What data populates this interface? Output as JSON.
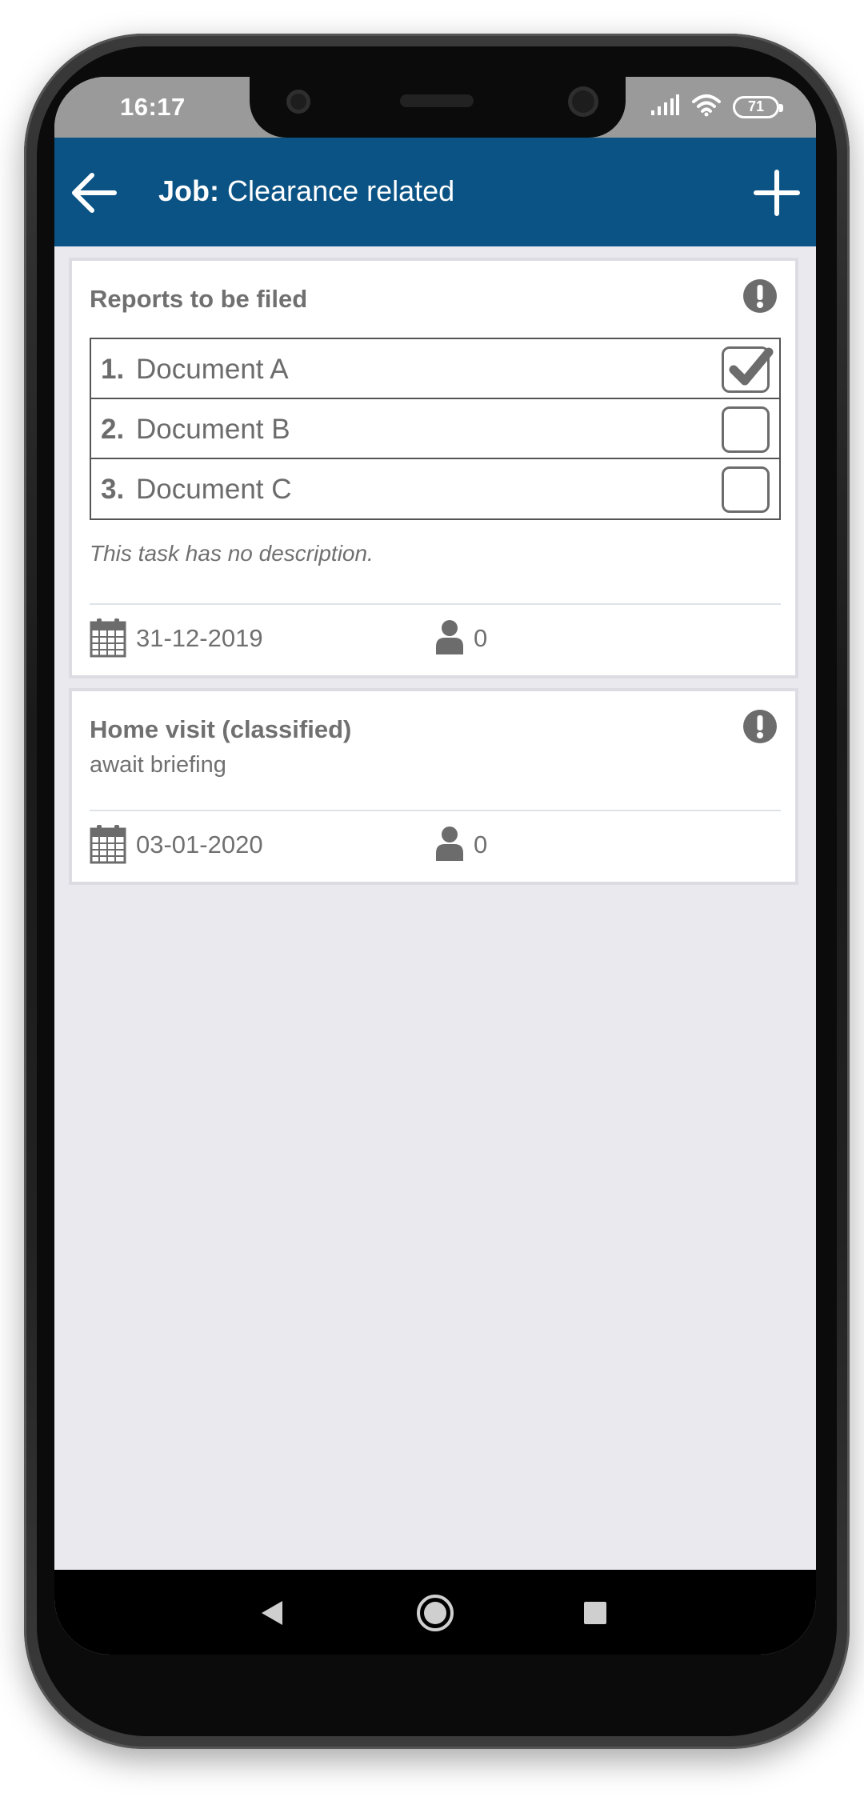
{
  "status_bar": {
    "time": "16:17",
    "battery": "71",
    "icons": [
      "signal-icon",
      "wifi-icon",
      "battery-icon"
    ]
  },
  "app_bar": {
    "title_label": "Job:",
    "title_value": "Clearance related",
    "back_icon": "arrow-left-icon",
    "add_icon": "plus-icon",
    "color": "#0a5384"
  },
  "tasks": [
    {
      "title": "Reports to be filed",
      "checklist": [
        {
          "num": "1.",
          "text": "Document A",
          "checked": true
        },
        {
          "num": "2.",
          "text": "Document B",
          "checked": false
        },
        {
          "num": "3.",
          "text": "Document C",
          "checked": false
        }
      ],
      "description": "This task has no description.",
      "date": "31-12-2019",
      "assignees": "0"
    },
    {
      "title": "Home visit (classified)",
      "subtitle": "await briefing",
      "date": "03-01-2020",
      "assignees": "0"
    }
  ],
  "nav_bar": {
    "icons": [
      "back-triangle-icon",
      "home-circle-icon",
      "recents-square-icon"
    ]
  }
}
